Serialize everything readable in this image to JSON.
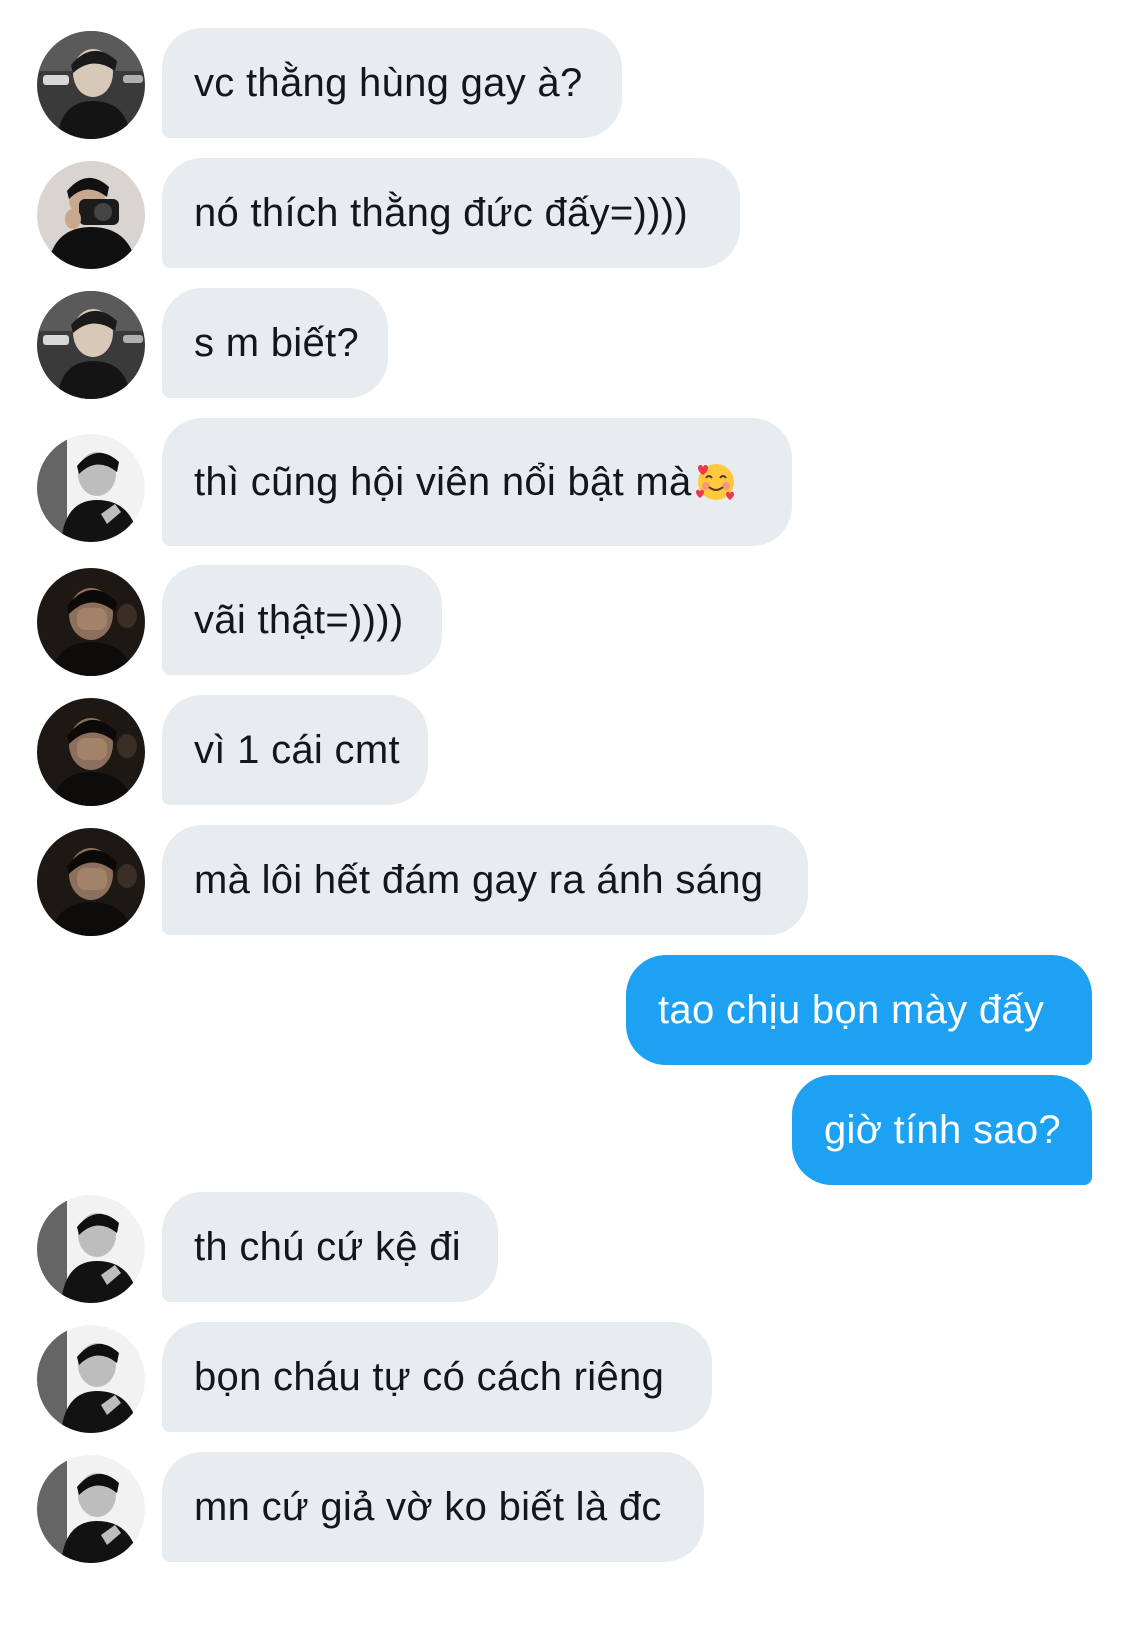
{
  "messages": [
    {
      "sender": "incoming",
      "avatar": "avatar-a",
      "text": "vc thằng hùng gay à?"
    },
    {
      "sender": "incoming",
      "avatar": "avatar-b",
      "text": "nó thích thằng đức đấy=))))"
    },
    {
      "sender": "incoming",
      "avatar": "avatar-a",
      "text": "s m biết?"
    },
    {
      "sender": "incoming",
      "avatar": "avatar-c",
      "text": "thì cũng hội viên nổi bật mà",
      "emoji": "smiling-face-with-hearts-icon"
    },
    {
      "sender": "incoming",
      "avatar": "avatar-d",
      "text": "vãi thật=))))"
    },
    {
      "sender": "incoming",
      "avatar": "avatar-d",
      "text": "vì 1 cái cmt"
    },
    {
      "sender": "incoming",
      "avatar": "avatar-d",
      "text": "mà lôi hết đám gay ra ánh sáng"
    },
    {
      "sender": "outgoing",
      "text": "tao chịu bọn mày đấy"
    },
    {
      "sender": "outgoing",
      "text": "giờ tính sao?"
    },
    {
      "sender": "incoming",
      "avatar": "avatar-c",
      "text": "th chú cứ kệ đi"
    },
    {
      "sender": "incoming",
      "avatar": "avatar-c",
      "text": "bọn cháu tự có cách riêng"
    },
    {
      "sender": "incoming",
      "avatar": "avatar-c",
      "text": "mn cứ giả vờ ko biết là đc"
    }
  ],
  "colors": {
    "incoming_bubble": "#e6ecf0",
    "outgoing_bubble": "#1da1f2",
    "incoming_text": "#14171a",
    "outgoing_text": "#ffffff"
  }
}
